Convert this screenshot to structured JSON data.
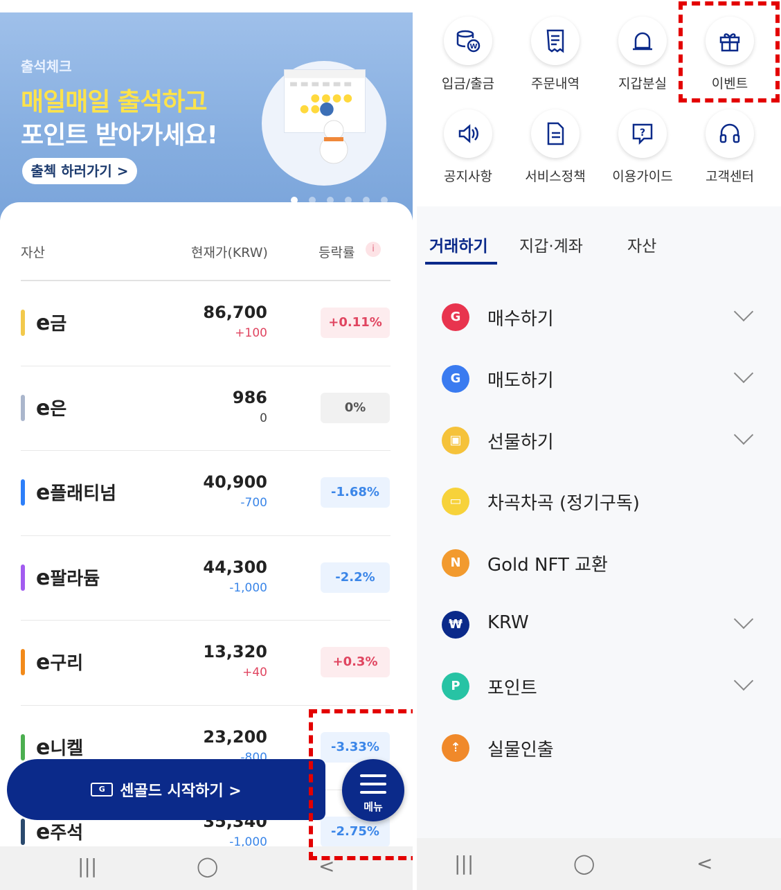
{
  "left": {
    "banner": {
      "tag": "출석체크",
      "headline": "매일매일 출석하고",
      "subline": "포인트 받아가세요!",
      "cta": "출첵 하러가기 >"
    },
    "table": {
      "col_asset": "자산",
      "col_price": "현재가(KRW)",
      "col_rate": "등락률",
      "info_badge": "i",
      "rows": [
        {
          "prefix": "e",
          "name": "금",
          "price": "86,700",
          "change": "+100",
          "rate": "+0.11%",
          "trend": "up",
          "color": "#f2c94c"
        },
        {
          "prefix": "e",
          "name": "은",
          "price": "986",
          "change": "0",
          "rate": "0%",
          "trend": "flat",
          "color": "#aab6cc"
        },
        {
          "prefix": "e",
          "name": "플래티넘",
          "price": "40,900",
          "change": "-700",
          "rate": "-1.68%",
          "trend": "down",
          "color": "#2d7ff9"
        },
        {
          "prefix": "e",
          "name": "팔라듐",
          "price": "44,300",
          "change": "-1,000",
          "rate": "-2.2%",
          "trend": "down",
          "color": "#a25cf0"
        },
        {
          "prefix": "e",
          "name": "구리",
          "price": "13,320",
          "change": "+40",
          "rate": "+0.3%",
          "trend": "up",
          "color": "#f28a1a"
        },
        {
          "prefix": "e",
          "name": "니켈",
          "price": "23,200",
          "change": "-800",
          "rate": "-3.33%",
          "trend": "down",
          "color": "#4caf50"
        },
        {
          "prefix": "e",
          "name": "주석",
          "price": "35,340",
          "change": "-1,000",
          "rate": "-2.75%",
          "trend": "down",
          "color": "#2b4a6e"
        }
      ]
    },
    "start_button": {
      "icon_text": "G",
      "label": "센골드 시작하기 >"
    },
    "menu_fab": {
      "label": "메뉴"
    },
    "navbar": {
      "recent": "|||",
      "home": "◯",
      "back": "<"
    }
  },
  "right": {
    "quick": [
      {
        "label": "입금/출금",
        "icon": "coin-stack-icon"
      },
      {
        "label": "주문내역",
        "icon": "receipt-icon"
      },
      {
        "label": "지갑분실",
        "icon": "alarm-bell-icon"
      },
      {
        "label": "이벤트",
        "icon": "gift-icon"
      },
      {
        "label": "공지사항",
        "icon": "speaker-icon"
      },
      {
        "label": "서비스정책",
        "icon": "document-icon"
      },
      {
        "label": "이용가이드",
        "icon": "help-bubble-icon"
      },
      {
        "label": "고객센터",
        "icon": "headset-icon"
      }
    ],
    "tabs": [
      "거래하기",
      "지갑·계좌",
      "자산"
    ],
    "menu": [
      {
        "label": "매수하기",
        "icon_color": "#e8344e",
        "glyph": "G",
        "expand": true
      },
      {
        "label": "매도하기",
        "icon_color": "#3a7bf0",
        "glyph": "G",
        "expand": true
      },
      {
        "label": "선물하기",
        "icon_color": "#f5c23a",
        "glyph": "▣",
        "expand": true
      },
      {
        "label": "차곡차곡 (정기구독)",
        "icon_color": "#f7d23a",
        "glyph": "▭",
        "expand": false
      },
      {
        "label": "Gold NFT 교환",
        "icon_color": "#f29a2e",
        "glyph": "N",
        "expand": false
      },
      {
        "label": "KRW",
        "icon_color": "#0b2a8a",
        "glyph": "₩",
        "expand": true
      },
      {
        "label": "포인트",
        "icon_color": "#27c3a4",
        "glyph": "P",
        "expand": true
      },
      {
        "label": "실물인출",
        "icon_color": "#f0892a",
        "glyph": "⇡",
        "expand": false
      }
    ],
    "navbar": {
      "recent": "|||",
      "home": "◯",
      "back": "<"
    }
  }
}
